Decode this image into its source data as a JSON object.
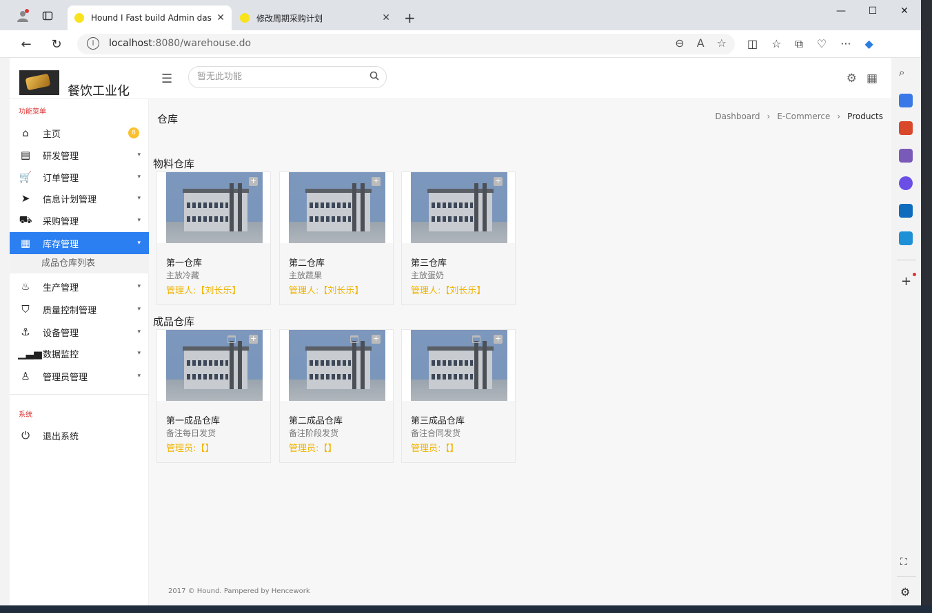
{
  "browser": {
    "tabs": [
      {
        "title": "Hound I Fast build Admin dashbo",
        "active": true
      },
      {
        "title": "修改周期采购计划",
        "active": false
      }
    ],
    "url_host": "localhost",
    "url_path": ":8080/warehouse.do"
  },
  "app": {
    "brand": "餐饮工业化",
    "search_placeholder": "暂无此功能"
  },
  "sidebar": {
    "section_main": "功能菜单",
    "items": [
      {
        "label": "主页",
        "icon": "home-icon",
        "badge": "8"
      },
      {
        "label": "研发管理",
        "icon": "book-icon"
      },
      {
        "label": "订单管理",
        "icon": "cart-icon"
      },
      {
        "label": "信息计划管理",
        "icon": "send-icon"
      },
      {
        "label": "采购管理",
        "icon": "truck-icon"
      },
      {
        "label": "库存管理",
        "icon": "grid-icon",
        "active": true
      },
      {
        "label": "生产管理",
        "icon": "fire-icon"
      },
      {
        "label": "质量控制管理",
        "icon": "html5-icon"
      },
      {
        "label": "设备管理",
        "icon": "anchor-icon"
      },
      {
        "label": "数据监控",
        "icon": "signal-icon"
      },
      {
        "label": "管理员管理",
        "icon": "user-icon"
      }
    ],
    "sub_item": "成品仓库列表",
    "section_system": "系统",
    "logout": "退出系统"
  },
  "main": {
    "title": "仓库",
    "breadcrumb": [
      "Dashboard",
      "E-Commerce",
      "Products"
    ],
    "groups": [
      {
        "title": "物料仓库",
        "cards": [
          {
            "name": "第一仓库",
            "note": "主放冷藏",
            "manager": "管理人:【刘长乐】"
          },
          {
            "name": "第二仓库",
            "note": "主放蔬果",
            "manager": "管理人:【刘长乐】"
          },
          {
            "name": "第三仓库",
            "note": "主放蛋奶",
            "manager": "管理人:【刘长乐】"
          }
        ]
      },
      {
        "title": "成品仓库",
        "cards": [
          {
            "name": "第一成品仓库",
            "note": "备注每日发货",
            "manager": "管理员:【】"
          },
          {
            "name": "第二成品仓库",
            "note": "备注阶段发货",
            "manager": "管理员:【】"
          },
          {
            "name": "第三成品仓库",
            "note": "备注合同发货",
            "manager": "管理员:【】"
          }
        ]
      }
    ],
    "footer": "2017 © Hound. Pampered by Hencework"
  },
  "colors": {
    "accent": "#2b7ff0",
    "manager_text": "#f0b400",
    "section_title": "#dd3333"
  }
}
